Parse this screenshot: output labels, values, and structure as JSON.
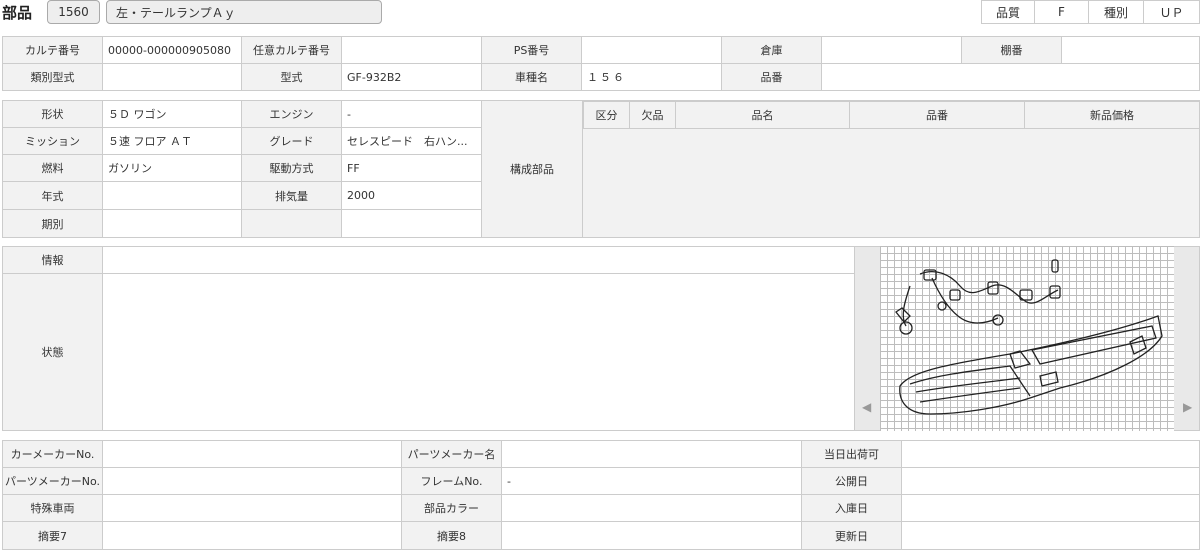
{
  "header": {
    "title": "部品",
    "part_no": "1560",
    "part_name": "左・テールランプＡｙ",
    "quality_label": "品質",
    "quality_value": "F",
    "type_label": "種別",
    "type_value": "ＵＰ"
  },
  "row1": {
    "karte_no_label": "カルテ番号",
    "karte_no": "00000-000000905080",
    "any_karte_label": "任意カルテ番号",
    "any_karte": "",
    "ps_label": "PS番号",
    "ps": "",
    "warehouse_label": "倉庫",
    "warehouse": "",
    "shelf_label": "棚番",
    "shelf": ""
  },
  "row2": {
    "class_model_label": "類別型式",
    "class_model": "",
    "model_label": "型式",
    "model": "GF-932B2",
    "car_name_label": "車種名",
    "car_name": "１５６",
    "part_number_label": "品番",
    "part_number": ""
  },
  "vehicle": {
    "shape_label": "形状",
    "shape": "５Ｄ ワゴン",
    "engine_label": "エンジン",
    "engine": "-",
    "mission_label": "ミッション",
    "mission": "５速 フロア ＡＴ",
    "grade_label": "グレード",
    "grade": "セレスピード　右ハン...",
    "fuel_label": "燃料",
    "fuel": "ガソリン",
    "drive_label": "駆動方式",
    "drive": "FF",
    "year_label": "年式",
    "year": "",
    "displacement_label": "排気量",
    "displacement": "2000",
    "period_label": "期別",
    "period": ""
  },
  "components": {
    "label": "構成部品",
    "headers": [
      "区分",
      "欠品",
      "品名",
      "品番",
      "新品価格"
    ]
  },
  "info": {
    "info_label": "情報",
    "info": "",
    "condition_label": "状態",
    "condition": ""
  },
  "bottom": {
    "car_maker_no_label": "カーメーカーNo.",
    "car_maker_no": "",
    "parts_maker_name_label": "パーツメーカー名",
    "parts_maker_name": "",
    "same_day_label": "当日出荷可",
    "parts_maker_no_label": "パーツメーカーNo.",
    "parts_maker_no": "",
    "frame_no_label": "フレームNo.",
    "frame_no": "-",
    "publish_date_label": "公開日",
    "special_vehicle_label": "特殊車両",
    "special_vehicle": "",
    "part_color_label": "部品カラー",
    "part_color": "",
    "arrival_date_label": "入庫日",
    "note7_label": "摘要7",
    "note7": "",
    "note8_label": "摘要8",
    "note8": "",
    "update_date_label": "更新日"
  },
  "image": {
    "prev_icon": "◀",
    "next_icon": "▶"
  }
}
